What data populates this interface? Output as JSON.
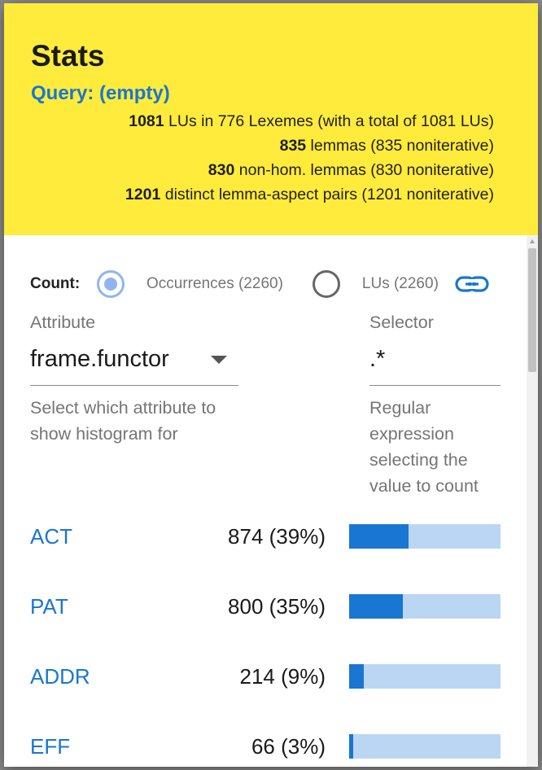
{
  "header": {
    "title": "Stats",
    "query": "Query: (empty)",
    "lines": [
      {
        "num": "1081",
        "text": " LUs in 776 Lexemes (with a total of 1081 LUs)"
      },
      {
        "num": "835",
        "text": " lemmas (835 noniterative)"
      },
      {
        "num": "830",
        "text": " non-hom. lemmas (830 noniterative)"
      },
      {
        "num": "1201",
        "text": " distinct lemma-aspect pairs (1201 noniterative)"
      }
    ]
  },
  "count": {
    "label": "Count:",
    "options": [
      {
        "label": "Occurrences (2260)",
        "checked": true
      },
      {
        "label": "LUs (2260)",
        "checked": false
      }
    ],
    "link_icon": "link-icon"
  },
  "attribute": {
    "caption": "Attribute",
    "value": "frame.functor",
    "hint": "Select which attribute to show histogram for"
  },
  "selector": {
    "caption": "Selector",
    "value": ".*",
    "hint": "Regular expression selecting the value to count"
  },
  "histogram": [
    {
      "name": "ACT",
      "count": "874 (39%)",
      "fraction": 0.39
    },
    {
      "name": "PAT",
      "count": "800 (35%)",
      "fraction": 0.355
    },
    {
      "name": "ADDR",
      "count": "214 (9%)",
      "fraction": 0.095
    },
    {
      "name": "EFF",
      "count": "66 (3%)",
      "fraction": 0.029
    }
  ],
  "colors": {
    "header_bg": "#ffeb3b",
    "accent": "#1976d2",
    "bar_track": "#bbd6f3",
    "radio_selected": "#90b4f0"
  }
}
